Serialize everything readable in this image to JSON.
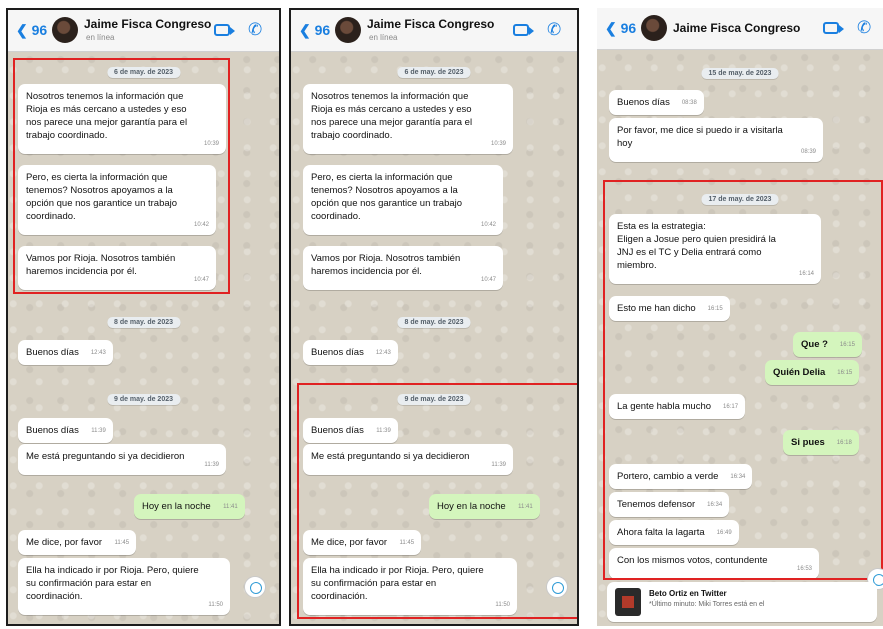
{
  "header": {
    "back_label": "96",
    "contact_name": "Jaime Fisca Congreso",
    "status": "en línea"
  },
  "panel1": {
    "dates": [
      "6 de may. de 2023",
      "8 de may. de 2023",
      "9 de may. de 2023"
    ],
    "messages": [
      {
        "text": "Nosotros tenemos la información que\nRioja es más cercano a ustedes y eso\nnos parece una mejor garantía para el\ntrabajo coordinado.",
        "time": "10:39"
      },
      {
        "text": "Pero, es cierta la información que\ntenemos? Nosotros apoyamos a la\nopción que nos garantice un trabajo\ncoordinado.",
        "time": "10:42"
      },
      {
        "text": "Vamos por Rioja. Nosotros también\nharemos incidencia por él.",
        "time": "10:47"
      },
      {
        "text": "Buenos días",
        "time": "12:43"
      },
      {
        "text": "Buenos días",
        "time": "11:39"
      },
      {
        "text": "Me está preguntando si ya decidieron",
        "time": "11:39"
      },
      {
        "text": "Hoy en la noche",
        "time": "11:41"
      },
      {
        "text": "Me dice, por favor",
        "time": "11:45"
      },
      {
        "text": "Ella ha indicado ir por Rioja. Pero, quiere\nsu confirmación para estar en\ncoordinación.",
        "time": "11:50"
      }
    ]
  },
  "panel2": {
    "dates": [
      "6 de may. de 2023",
      "8 de may. de 2023",
      "9 de may. de 2023"
    ],
    "messages": [
      {
        "text": "Nosotros tenemos la información que\nRioja es más cercano a ustedes y eso\nnos parece una mejor garantía para el\ntrabajo coordinado.",
        "time": "10:39"
      },
      {
        "text": "Pero, es cierta la información que\ntenemos? Nosotros apoyamos a la\nopción que nos garantice un trabajo\ncoordinado.",
        "time": "10:42"
      },
      {
        "text": "Vamos por Rioja. Nosotros también\nharemos incidencia por él.",
        "time": "10:47"
      },
      {
        "text": "Buenos días",
        "time": "12:43"
      },
      {
        "text": "Buenos días",
        "time": "11:39"
      },
      {
        "text": "Me está preguntando si ya decidieron",
        "time": "11:39"
      },
      {
        "text": "Hoy en la noche",
        "time": "11:41"
      },
      {
        "text": "Me dice, por favor",
        "time": "11:45"
      },
      {
        "text": "Ella ha indicado ir por Rioja. Pero, quiere\nsu confirmación para estar en\ncoordinación.",
        "time": "11:50"
      }
    ]
  },
  "panel3": {
    "dates": [
      "15 de may. de 2023",
      "17 de may. de 2023"
    ],
    "messages": [
      {
        "text": "Buenos días",
        "time": "08:38"
      },
      {
        "text": "Por favor, me dice si puedo ir a visitarla\nhoy",
        "time": "08:39"
      },
      {
        "text": "Esta es la estrategia:\nEligen a Josue pero quien presidirá la\nJNJ es el TC y Delia entrará como\nmiembro.",
        "time": "16:14"
      },
      {
        "text": "Esto me han dicho",
        "time": "16:15"
      },
      {
        "text": "Que ?",
        "time": "16:15"
      },
      {
        "text": "Quién Delia",
        "time": "16:15"
      },
      {
        "text": "La gente habla mucho",
        "time": "16:17"
      },
      {
        "text": "Si pues",
        "time": "16:18"
      },
      {
        "text": "Portero, cambio a verde",
        "time": "16:34"
      },
      {
        "text": "Tenemos defensor",
        "time": "16:34"
      },
      {
        "text": "Ahora falta la lagarta",
        "time": "16:49"
      },
      {
        "text": "Con los mismos votos, contundente",
        "time": "16:53"
      }
    ],
    "notification": {
      "title": "Beto Ortiz en Twitter",
      "text": "*Último minuto: Miki Torres está en el"
    }
  },
  "icons": [
    "back-chevron-icon",
    "contact-avatar",
    "video-call-icon",
    "phone-icon",
    "scroll-down-icon"
  ],
  "colors": {
    "highlight": "#e02222",
    "accent": "#1a7fe0",
    "outgoing_bubble": "#d4f5bd",
    "incoming_bubble": "#ffffff"
  }
}
